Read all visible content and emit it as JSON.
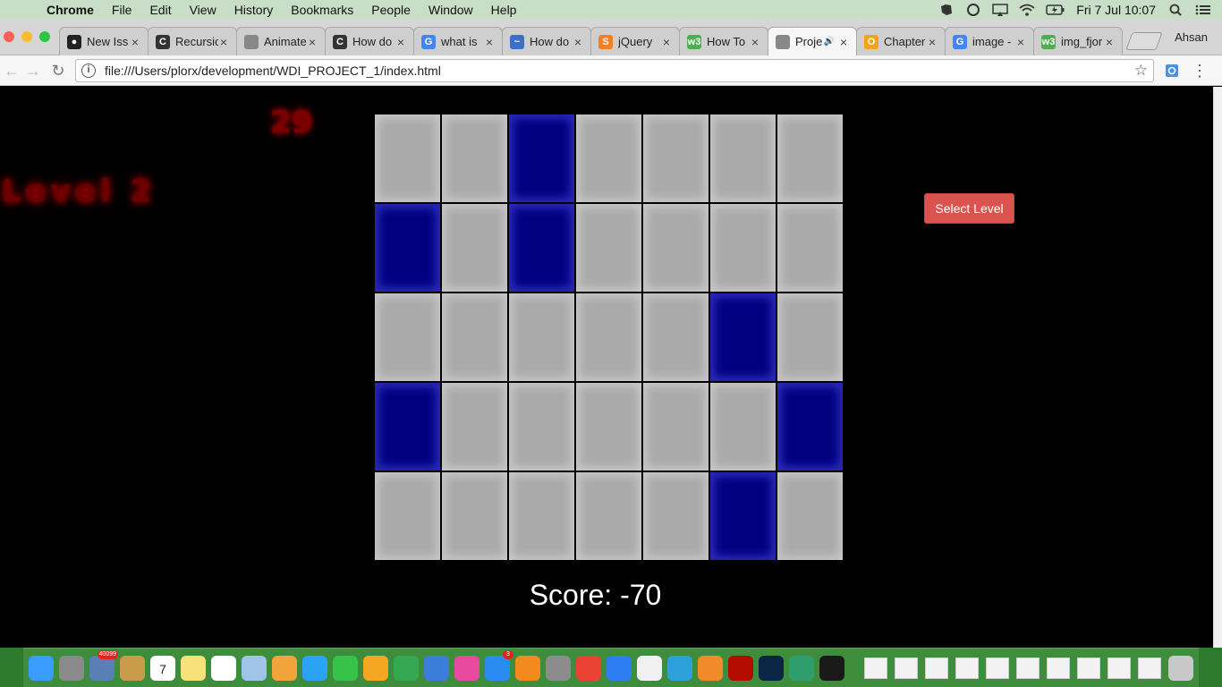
{
  "menubar": {
    "app": "Chrome",
    "items": [
      "File",
      "Edit",
      "View",
      "History",
      "Bookmarks",
      "People",
      "Window",
      "Help"
    ],
    "clock": "Fri 7 Jul  10:07"
  },
  "browser": {
    "tabs": [
      {
        "title": "New Iss",
        "icon": "github-icon",
        "color": "#222222",
        "glyph": "●"
      },
      {
        "title": "Recursio",
        "icon": "codepen-icon",
        "color": "#333333",
        "glyph": "C"
      },
      {
        "title": "Animate",
        "icon": "page-icon",
        "color": "#888888",
        "glyph": ""
      },
      {
        "title": "How do",
        "icon": "codepen-icon",
        "color": "#333333",
        "glyph": "C"
      },
      {
        "title": "what is",
        "icon": "google-icon",
        "color": "#4285f4",
        "glyph": "G"
      },
      {
        "title": "How do",
        "icon": "stackoverflow-icon",
        "color": "#3d6ec9",
        "glyph": "~"
      },
      {
        "title": "jQuery",
        "icon": "stackoverflow-icon",
        "color": "#f48024",
        "glyph": "S"
      },
      {
        "title": "How To",
        "icon": "w3schools-icon",
        "color": "#4caf50",
        "glyph": "w3"
      },
      {
        "title": "Proje",
        "icon": "page-icon",
        "color": "#888888",
        "glyph": "",
        "active": true,
        "audio": "🔊"
      },
      {
        "title": "Chapter",
        "icon": "opera-icon",
        "color": "#f4a31a",
        "glyph": "O"
      },
      {
        "title": "image -",
        "icon": "google-icon",
        "color": "#4285f4",
        "glyph": "G"
      },
      {
        "title": "img_fjor",
        "icon": "w3schools-icon",
        "color": "#4caf50",
        "glyph": "w3"
      }
    ],
    "profile": "Ahsan",
    "url": "file:///Users/plorx/development/WDI_PROJECT_1/index.html"
  },
  "game": {
    "timer": "29",
    "level": "Level 2",
    "select_level_label": "Select Level",
    "score": "Score: -70",
    "grid_cols": 7,
    "grid_rows": 5,
    "active_cells": [
      [
        0,
        0,
        1,
        0,
        0,
        0,
        0
      ],
      [
        1,
        0,
        1,
        0,
        0,
        0,
        0
      ],
      [
        0,
        0,
        0,
        0,
        0,
        1,
        0
      ],
      [
        1,
        0,
        0,
        0,
        0,
        0,
        1
      ],
      [
        0,
        0,
        0,
        0,
        0,
        1,
        0
      ]
    ],
    "colors": {
      "active": "#000080",
      "inactive": "#aaaaaa",
      "button": "#d9534f"
    }
  },
  "dock": {
    "apps": [
      {
        "name": "finder-icon",
        "color": "#3b9cff"
      },
      {
        "name": "launchpad-icon",
        "color": "#8a8a8a"
      },
      {
        "name": "mail-stamps-icon",
        "color": "#5a7fb5",
        "badge": "40099"
      },
      {
        "name": "contacts-icon",
        "color": "#c99a4a"
      },
      {
        "name": "calendar-icon",
        "color": "#ffffff",
        "label": "7"
      },
      {
        "name": "notes-icon",
        "color": "#f7e27a"
      },
      {
        "name": "reminders-icon",
        "color": "#ffffff"
      },
      {
        "name": "preview-icon",
        "color": "#9fc4e8"
      },
      {
        "name": "photos-icon",
        "color": "#f2a33a"
      },
      {
        "name": "messages-icon",
        "color": "#2aa3f5"
      },
      {
        "name": "facetime-icon",
        "color": "#37c24a"
      },
      {
        "name": "pages-icon",
        "color": "#f5a623"
      },
      {
        "name": "numbers-icon",
        "color": "#35a853"
      },
      {
        "name": "keynote-icon",
        "color": "#3b7dd8"
      },
      {
        "name": "itunes-icon",
        "color": "#e84aa0"
      },
      {
        "name": "app-store-icon",
        "color": "#2a8cf0",
        "badge": "3"
      },
      {
        "name": "ibooks-icon",
        "color": "#f38a1d"
      },
      {
        "name": "system-preferences-icon",
        "color": "#8c8c8c"
      },
      {
        "name": "chrome-icon",
        "color": "#e94235"
      },
      {
        "name": "safari-icon",
        "color": "#2d7ef2"
      },
      {
        "name": "textedit-icon",
        "color": "#f0f0f0"
      },
      {
        "name": "markdown-icon",
        "color": "#2d9fd9"
      },
      {
        "name": "sublime-icon",
        "color": "#f08a2a"
      },
      {
        "name": "acrobat-icon",
        "color": "#b30b00"
      },
      {
        "name": "photoshop-icon",
        "color": "#0b2645"
      },
      {
        "name": "atom-icon",
        "color": "#2f9e6d"
      },
      {
        "name": "terminal-icon",
        "color": "#1a1a1a"
      }
    ]
  }
}
